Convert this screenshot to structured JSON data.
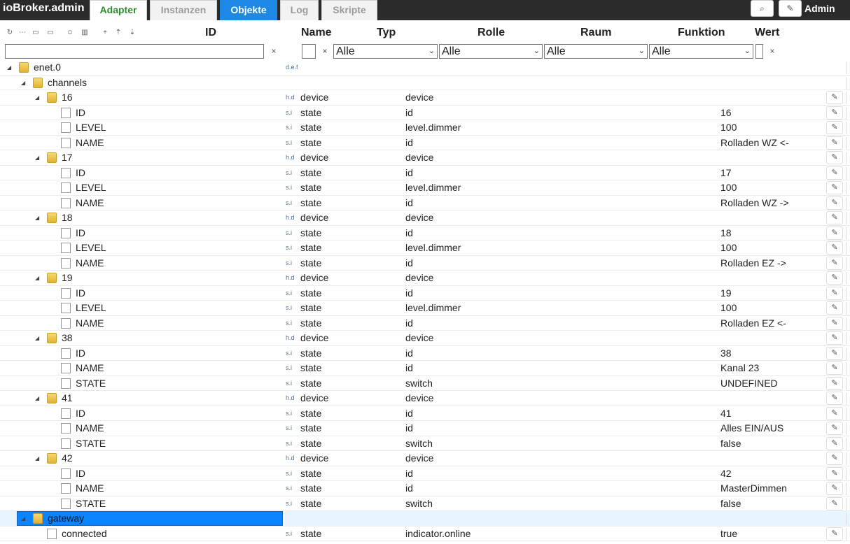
{
  "app": {
    "title": "ioBroker.admin",
    "user": "Admin"
  },
  "tabs": [
    {
      "id": "adapter",
      "label": "Adapter"
    },
    {
      "id": "instanzen",
      "label": "Instanzen"
    },
    {
      "id": "objekte",
      "label": "Objekte",
      "active": true
    },
    {
      "id": "log",
      "label": "Log"
    },
    {
      "id": "skripte",
      "label": "Skripte"
    }
  ],
  "top_icons": {
    "search": "search-icon",
    "edit": "pencil-icon"
  },
  "toolbar_icons": [
    "refresh-icon",
    "collapse-all-icon",
    "folder-open-icon",
    "folder-icon",
    "user-icon",
    "expert-icon",
    "add-icon",
    "upload-icon",
    "download-icon"
  ],
  "columns": {
    "id": "ID",
    "name": "Name",
    "typ": "Typ",
    "rolle": "Rolle",
    "raum": "Raum",
    "funktion": "Funktion",
    "wert": "Wert"
  },
  "filters": {
    "id_value": "",
    "typ": "Alle",
    "rolle": "Alle",
    "raum": "Alle",
    "funktion": "Alle",
    "clear": "×"
  },
  "rows": [
    {
      "label": "enet.0",
      "level": 0,
      "kind": "folder",
      "type": "",
      "role": "",
      "value": "",
      "typeicon": "d.e.f"
    },
    {
      "label": "channels",
      "level": 1,
      "kind": "folder",
      "type": "",
      "role": "",
      "value": "",
      "typeicon": ""
    },
    {
      "label": "16",
      "level": 2,
      "kind": "folder",
      "type": "device",
      "role": "device",
      "value": "",
      "typeicon": "h.d"
    },
    {
      "label": "ID",
      "level": 3,
      "kind": "file",
      "type": "state",
      "role": "id",
      "value": "16",
      "typeicon": "s.i"
    },
    {
      "label": "LEVEL",
      "level": 3,
      "kind": "file",
      "type": "state",
      "role": "level.dimmer",
      "value": "100",
      "typeicon": "s.i"
    },
    {
      "label": "NAME",
      "level": 3,
      "kind": "file",
      "type": "state",
      "role": "id",
      "value": "Rolladen WZ <-",
      "typeicon": "s.i"
    },
    {
      "label": "17",
      "level": 2,
      "kind": "folder",
      "type": "device",
      "role": "device",
      "value": "",
      "typeicon": "h.d"
    },
    {
      "label": "ID",
      "level": 3,
      "kind": "file",
      "type": "state",
      "role": "id",
      "value": "17",
      "typeicon": "s.i"
    },
    {
      "label": "LEVEL",
      "level": 3,
      "kind": "file",
      "type": "state",
      "role": "level.dimmer",
      "value": "100",
      "typeicon": "s.i"
    },
    {
      "label": "NAME",
      "level": 3,
      "kind": "file",
      "type": "state",
      "role": "id",
      "value": "Rolladen WZ ->",
      "typeicon": "s.i"
    },
    {
      "label": "18",
      "level": 2,
      "kind": "folder",
      "type": "device",
      "role": "device",
      "value": "",
      "typeicon": "h.d"
    },
    {
      "label": "ID",
      "level": 3,
      "kind": "file",
      "type": "state",
      "role": "id",
      "value": "18",
      "typeicon": "s.i"
    },
    {
      "label": "LEVEL",
      "level": 3,
      "kind": "file",
      "type": "state",
      "role": "level.dimmer",
      "value": "100",
      "typeicon": "s.i"
    },
    {
      "label": "NAME",
      "level": 3,
      "kind": "file",
      "type": "state",
      "role": "id",
      "value": "Rolladen EZ ->",
      "typeicon": "s.i"
    },
    {
      "label": "19",
      "level": 2,
      "kind": "folder",
      "type": "device",
      "role": "device",
      "value": "",
      "typeicon": "h.d"
    },
    {
      "label": "ID",
      "level": 3,
      "kind": "file",
      "type": "state",
      "role": "id",
      "value": "19",
      "typeicon": "s.i"
    },
    {
      "label": "LEVEL",
      "level": 3,
      "kind": "file",
      "type": "state",
      "role": "level.dimmer",
      "value": "100",
      "typeicon": "s.i"
    },
    {
      "label": "NAME",
      "level": 3,
      "kind": "file",
      "type": "state",
      "role": "id",
      "value": "Rolladen EZ <-",
      "typeicon": "s.i"
    },
    {
      "label": "38",
      "level": 2,
      "kind": "folder",
      "type": "device",
      "role": "device",
      "value": "",
      "typeicon": "h.d"
    },
    {
      "label": "ID",
      "level": 3,
      "kind": "file",
      "type": "state",
      "role": "id",
      "value": "38",
      "typeicon": "s.i"
    },
    {
      "label": "NAME",
      "level": 3,
      "kind": "file",
      "type": "state",
      "role": "id",
      "value": "Kanal 23",
      "typeicon": "s.i"
    },
    {
      "label": "STATE",
      "level": 3,
      "kind": "file",
      "type": "state",
      "role": "switch",
      "value": "UNDEFINED",
      "typeicon": "s.i"
    },
    {
      "label": "41",
      "level": 2,
      "kind": "folder",
      "type": "device",
      "role": "device",
      "value": "",
      "typeicon": "h.d"
    },
    {
      "label": "ID",
      "level": 3,
      "kind": "file",
      "type": "state",
      "role": "id",
      "value": "41",
      "typeicon": "s.i"
    },
    {
      "label": "NAME",
      "level": 3,
      "kind": "file",
      "type": "state",
      "role": "id",
      "value": "Alles EIN/AUS",
      "typeicon": "s.i"
    },
    {
      "label": "STATE",
      "level": 3,
      "kind": "file",
      "type": "state",
      "role": "switch",
      "value": "false",
      "typeicon": "s.i"
    },
    {
      "label": "42",
      "level": 2,
      "kind": "folder",
      "type": "device",
      "role": "device",
      "value": "",
      "typeicon": "h.d"
    },
    {
      "label": "ID",
      "level": 3,
      "kind": "file",
      "type": "state",
      "role": "id",
      "value": "42",
      "typeicon": "s.i"
    },
    {
      "label": "NAME",
      "level": 3,
      "kind": "file",
      "type": "state",
      "role": "id",
      "value": "MasterDimmen",
      "typeicon": "s.i"
    },
    {
      "label": "STATE",
      "level": 3,
      "kind": "file",
      "type": "state",
      "role": "switch",
      "value": "false",
      "typeicon": "s.i"
    },
    {
      "label": "gateway",
      "level": 1,
      "kind": "folder",
      "type": "",
      "role": "",
      "value": "",
      "typeicon": "",
      "selected": true
    },
    {
      "label": "connected",
      "level": 2,
      "kind": "file",
      "type": "state",
      "role": "indicator.online",
      "value": "true",
      "typeicon": "s.i"
    }
  ]
}
